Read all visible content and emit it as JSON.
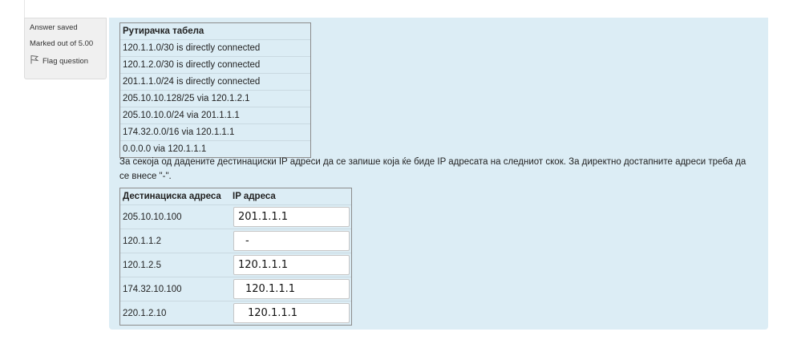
{
  "info": {
    "state": "Answer saved",
    "grade": "Marked out of 5.00",
    "flag_label": "Flag question"
  },
  "routing_table": {
    "header": "Рутирачка табела",
    "rows": [
      "120.1.1.0/30 is directly connected",
      "120.1.2.0/30 is directly connected",
      "201.1.1.0/24 is directly connected",
      "205.10.10.128/25 via 120.1.2.1",
      "205.10.10.0/24 via 201.1.1.1",
      "174.32.0.0/16 via 120.1.1.1",
      "0.0.0.0 via 120.1.1.1"
    ]
  },
  "instructions": "За секоја од дадените дестинациски IP адреси да се запише која ќе биде IP адресата на следниот скок. За директно достапните адреси треба да се внесе \"-\".",
  "answer_table": {
    "col_destination": "Дестинациска адреса",
    "col_ip": "IP адреса",
    "rows": [
      {
        "destination": "205.10.10.100",
        "answer": "201.1.1.1"
      },
      {
        "destination": "120.1.1.2",
        "answer": "-"
      },
      {
        "destination": "120.1.2.5",
        "answer": "120.1.1.1"
      },
      {
        "destination": "174.32.10.100",
        "answer": "120.1.1.1"
      },
      {
        "destination": "220.1.2.10",
        "answer": "120.1.1.1"
      }
    ]
  },
  "icons": {
    "flag": "flag-icon"
  }
}
